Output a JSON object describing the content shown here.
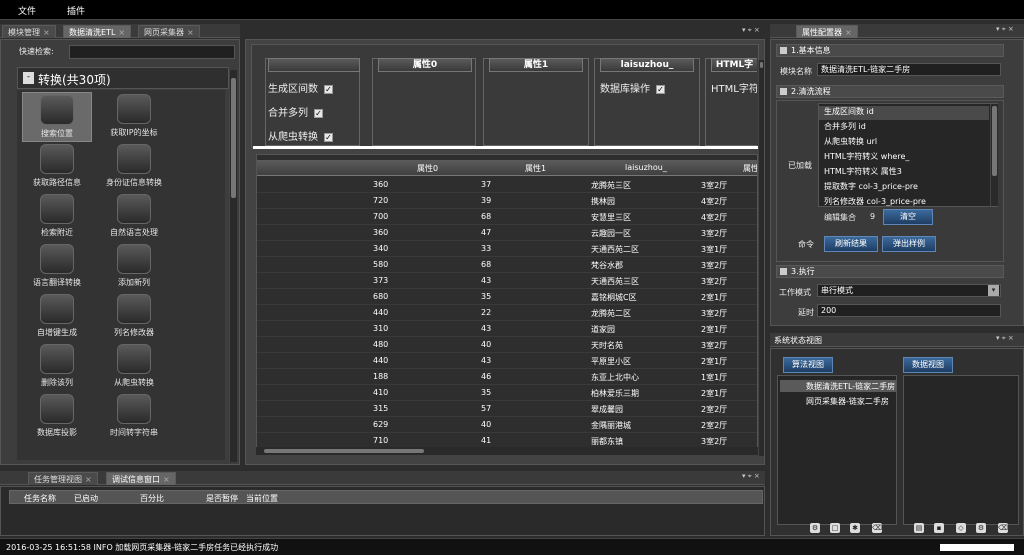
{
  "menu": [
    "文件",
    "插件"
  ],
  "left_tabs": [
    "模块管理",
    "数据清洗ETL",
    "网页采集器"
  ],
  "quick_search_label": "快速检索:",
  "quick_search_value": "",
  "group_title": "转换(共30项)",
  "modules": [
    "搜索位置",
    "获取IP的坐标",
    "获取路径信息",
    "身份证信息转换",
    "检索附近",
    "自然语言处理",
    "语言翻译转换",
    "添加新列",
    "自增键生成",
    "列名修改器",
    "删除该列",
    "从爬虫转换",
    "数据库投影",
    "时间转字符串"
  ],
  "options": [
    {
      "label": "生成区间数",
      "checked": true
    },
    {
      "label": "合并多列",
      "checked": true
    },
    {
      "label": "从爬虫转换",
      "checked": true
    }
  ],
  "top_columns": [
    "",
    "属性0",
    "属性1",
    "laisuzhou_",
    "HTML字"
  ],
  "col3_option": {
    "label": "数据库操作",
    "checked": true
  },
  "col4_text": "HTML字符",
  "grid": {
    "headers": [
      "属性0",
      "属性1",
      "laisuzhou_",
      "属性"
    ],
    "rows": [
      [
        "360",
        "37",
        "龙腾苑三区",
        "3室2厅"
      ],
      [
        "720",
        "39",
        "携林园",
        "4室2厅"
      ],
      [
        "700",
        "68",
        "安慧里三区",
        "4室2厅"
      ],
      [
        "360",
        "47",
        "云趣园一区",
        "3室2厅"
      ],
      [
        "340",
        "33",
        "天通西苑二区",
        "3室1厅"
      ],
      [
        "580",
        "68",
        "梵谷水郡",
        "3室2厅"
      ],
      [
        "373",
        "43",
        "天通西苑三区",
        "3室2厅"
      ],
      [
        "680",
        "35",
        "嘉铭桐城C区",
        "2室1厅"
      ],
      [
        "440",
        "22",
        "龙腾苑二区",
        "3室2厅"
      ],
      [
        "310",
        "43",
        "道家园",
        "2室1厅"
      ],
      [
        "480",
        "40",
        "天时名苑",
        "3室2厅"
      ],
      [
        "440",
        "43",
        "平原里小区",
        "2室1厅"
      ],
      [
        "188",
        "46",
        "东亚上北中心",
        "1室1厅"
      ],
      [
        "410",
        "35",
        "柏林爱乐三期",
        "2室1厅"
      ],
      [
        "315",
        "57",
        "翠成馨园",
        "2室2厅"
      ],
      [
        "629",
        "40",
        "金隅丽港城",
        "2室2厅"
      ],
      [
        "710",
        "41",
        "丽都东镇",
        "3室2厅"
      ]
    ]
  },
  "bottom_tabs": [
    "任务管理视图",
    "调试信息窗口"
  ],
  "task_headers": [
    "任务名称",
    "已启动",
    "百分比",
    "是否暂停",
    "当前位置"
  ],
  "right_tab": "属性配置器",
  "basic_info": {
    "title": "1.基本信息",
    "label": "模块名称",
    "value": "数据清洗ETL-链家二手房"
  },
  "flow": {
    "title": "2.清洗流程",
    "loaded_label": "已加载",
    "items": [
      "生成区间数 id",
      "合并多列 id",
      "从爬虫转换 url",
      "HTML字符转义 where_",
      "HTML字符转义 属性3",
      "提取数字 col-3_price-pre",
      "列名修改器 col-3_price-pre"
    ],
    "edit_label": "编辑集合",
    "edit_count": "9",
    "clear_button": "清空",
    "command_label": "命令",
    "refresh_button": "刷新结果",
    "sample_button": "弹出样例"
  },
  "execute": {
    "title": "3.执行",
    "mode_label": "工作模式",
    "mode_value": "串行模式",
    "delay_label": "延时",
    "delay_value": "200"
  },
  "status_view": {
    "title": "系统状态视图",
    "algo_button": "算法视图",
    "data_button": "数据视图",
    "items": [
      "数据清洗ETL-链家二手房",
      "网页采集器-链家二手房"
    ]
  },
  "status_bar": "2016-03-25 16:51:58 INFO  加载网页采集器-链家二手房任务已经执行成功",
  "colors": {
    "accent_blue": "#2b5082",
    "background": "#2d2d2d",
    "panel": "#3d3d3d"
  }
}
